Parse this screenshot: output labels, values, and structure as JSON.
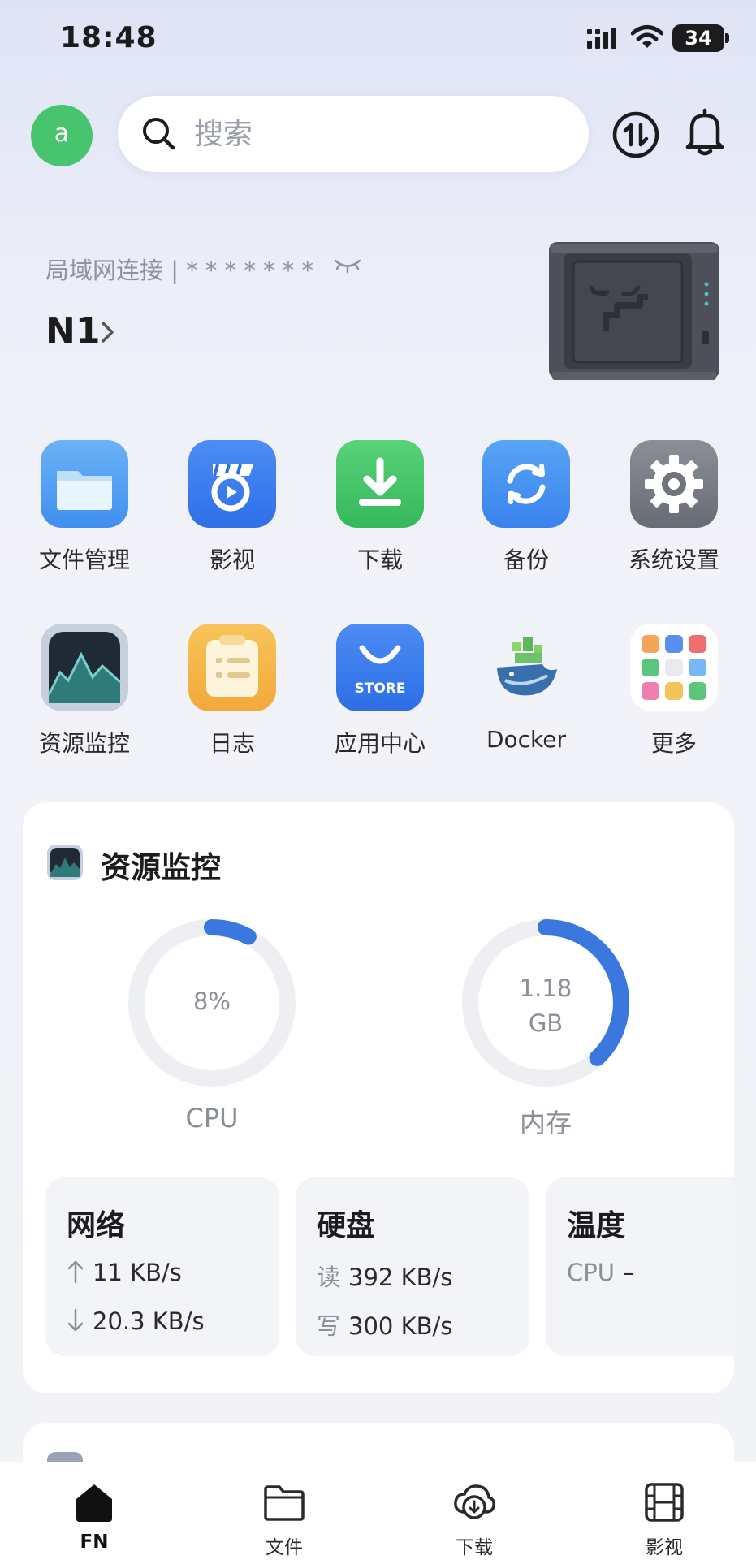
{
  "status_bar": {
    "time": "18:48",
    "battery": "34"
  },
  "header": {
    "avatar_letter": "a",
    "search_placeholder": "搜索"
  },
  "device": {
    "connection_label": "局域网连接 | * * * * * * *",
    "name": "N1"
  },
  "apps": [
    {
      "label": "文件管理",
      "icon": "folder-icon"
    },
    {
      "label": "影视",
      "icon": "video-icon"
    },
    {
      "label": "下载",
      "icon": "download-icon"
    },
    {
      "label": "备份",
      "icon": "backup-icon"
    },
    {
      "label": "系统设置",
      "icon": "gear-icon"
    },
    {
      "label": "资源监控",
      "icon": "monitor-chart-icon"
    },
    {
      "label": "日志",
      "icon": "log-icon"
    },
    {
      "label": "应用中心",
      "icon": "store-icon",
      "badge_text": "STORE"
    },
    {
      "label": "Docker",
      "icon": "docker-whale-icon"
    },
    {
      "label": "更多",
      "icon": "more-grid-icon"
    }
  ],
  "monitor": {
    "title": "资源监控",
    "cpu": {
      "value": "8%",
      "label": "CPU",
      "fraction": 0.08
    },
    "memory": {
      "value_line1": "1.18",
      "value_line2": "GB",
      "label": "内存",
      "fraction": 0.38
    },
    "network": {
      "title": "网络",
      "up": "11 KB/s",
      "down": "20.3 KB/s"
    },
    "disk": {
      "title": "硬盘",
      "read_prefix": "读",
      "read": "392 KB/s",
      "write_prefix": "写",
      "write": "300 KB/s"
    },
    "temperature": {
      "title": "温度",
      "cpu_label": "CPU",
      "cpu_value": "–"
    }
  },
  "tabs": [
    {
      "label": "FN",
      "icon": "home-icon",
      "active": true
    },
    {
      "label": "文件",
      "icon": "folder-icon"
    },
    {
      "label": "下载",
      "icon": "download-circle-icon"
    },
    {
      "label": "影视",
      "icon": "film-icon"
    }
  ],
  "colors": {
    "accent": "#3a78e0",
    "avatar": "#47c46d",
    "ring_track": "#eeeff2"
  }
}
